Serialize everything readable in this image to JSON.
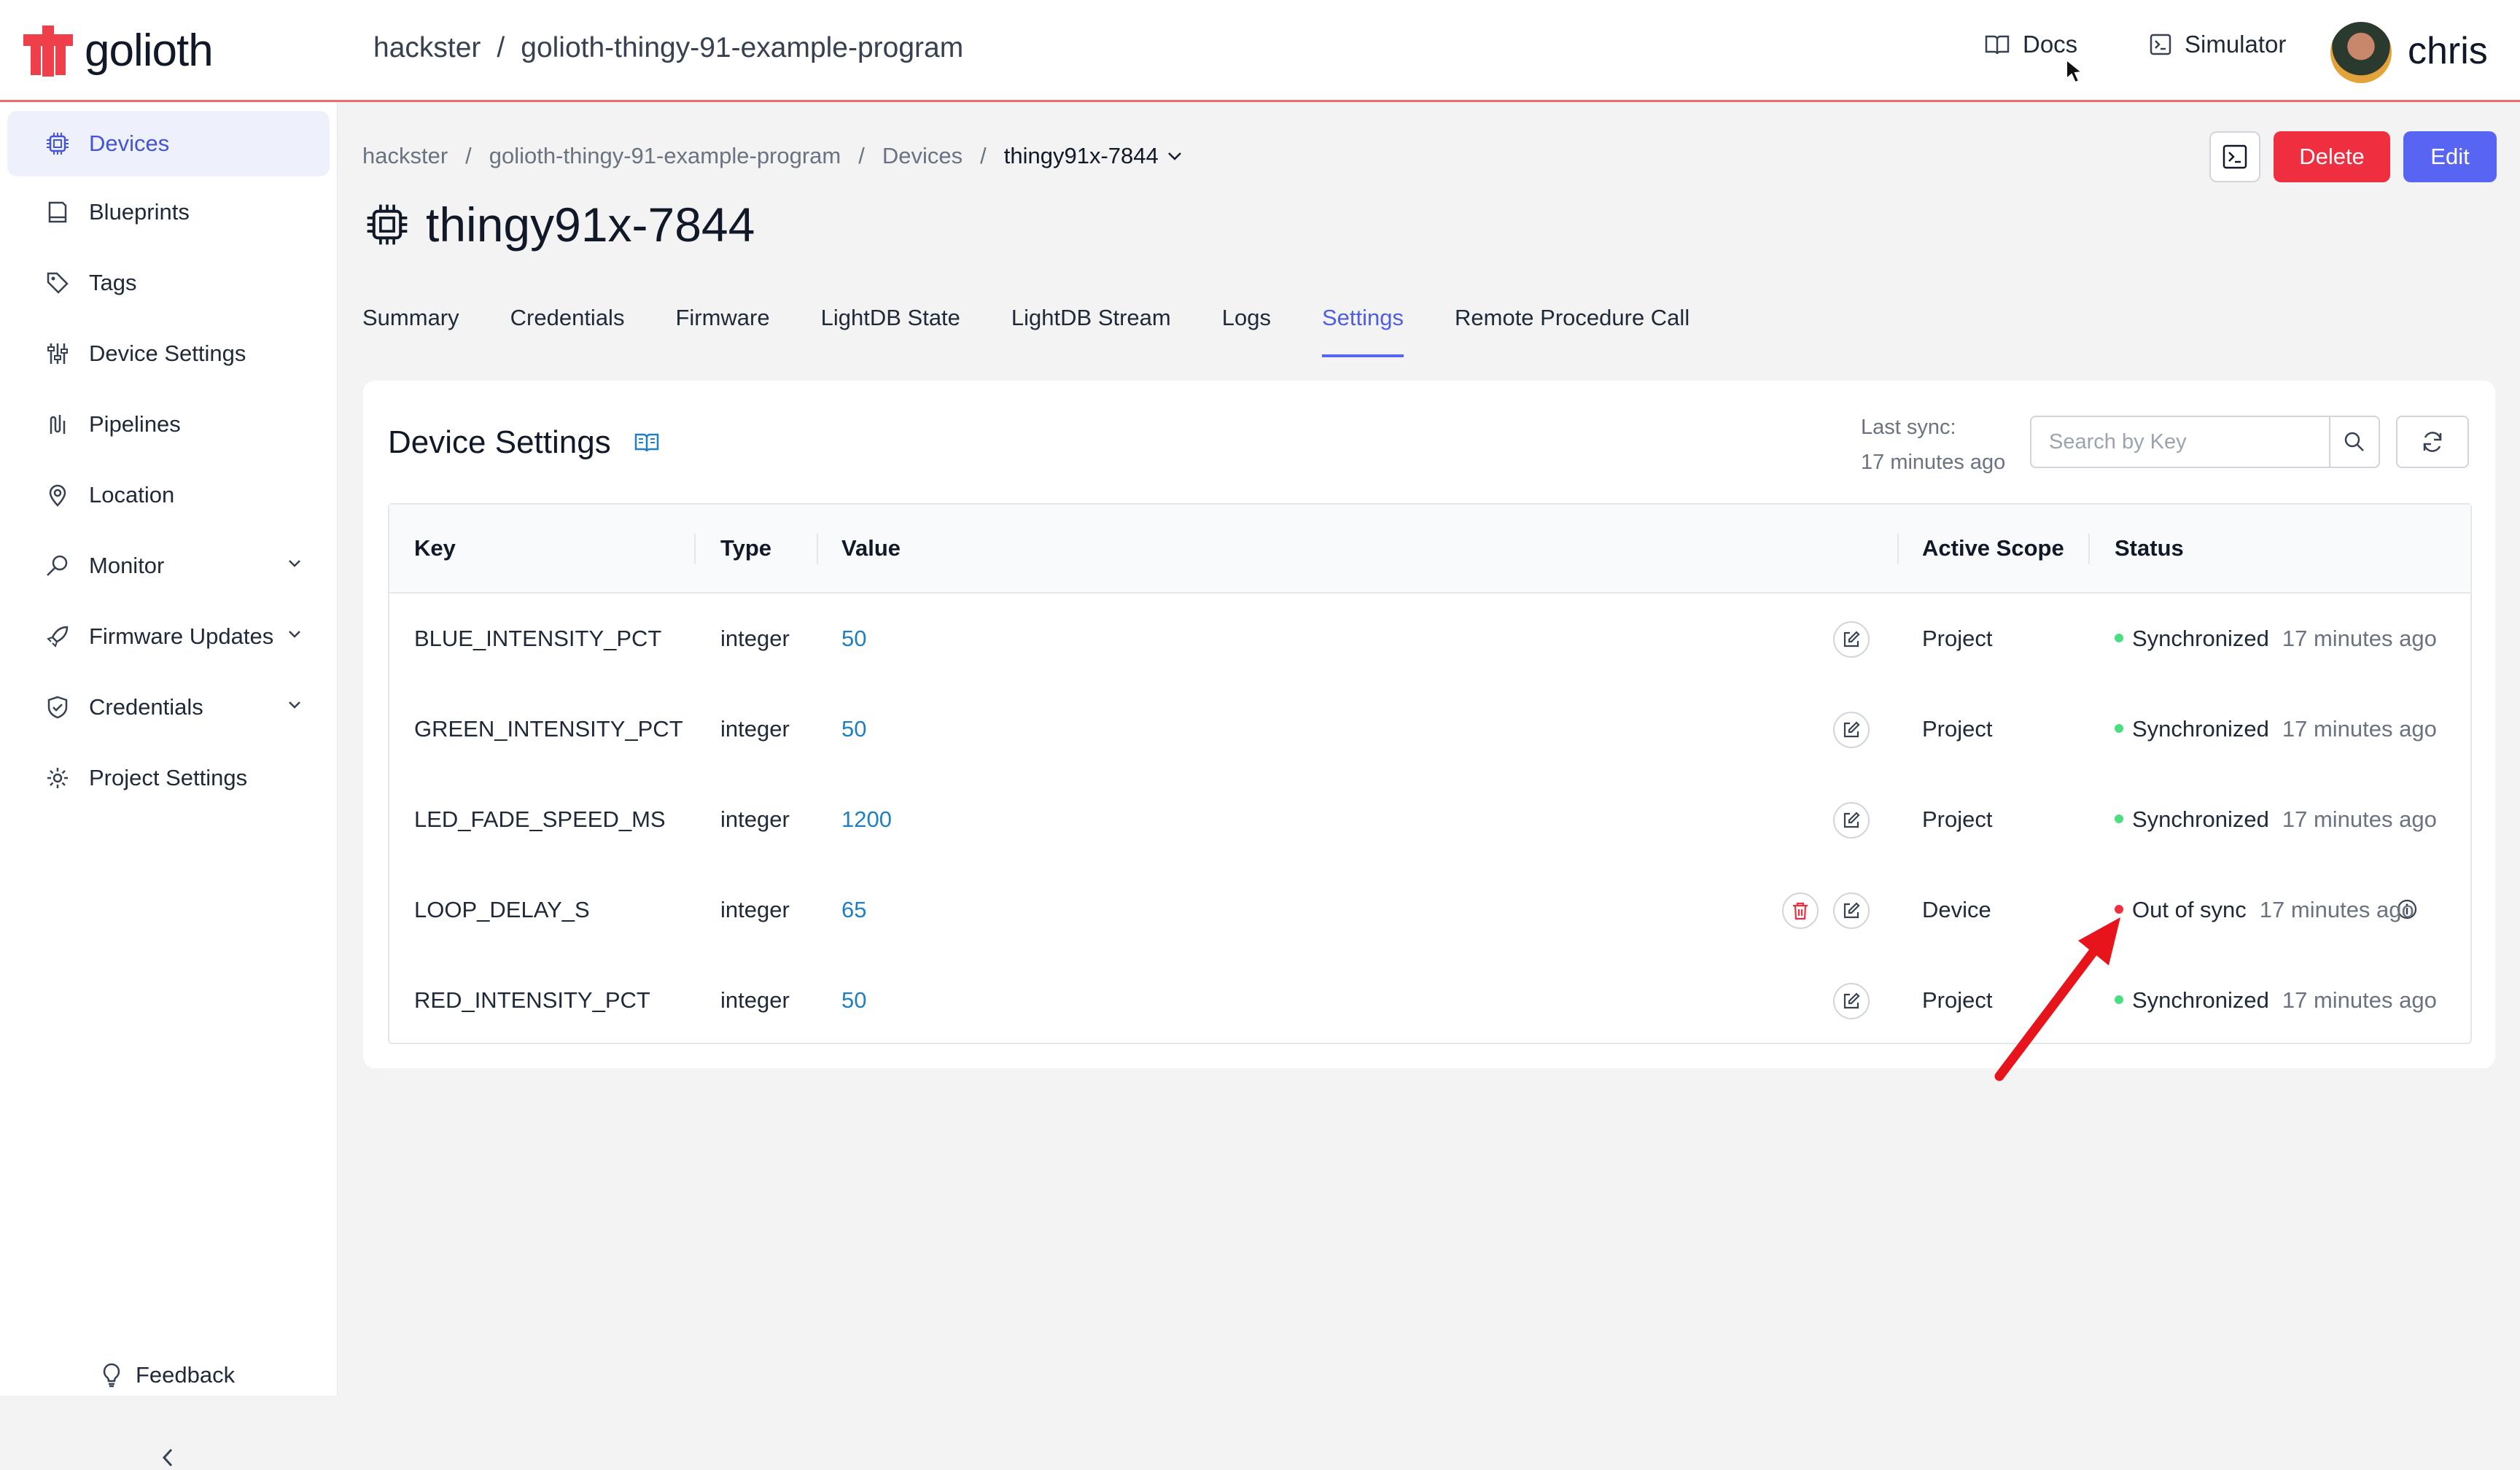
{
  "app": {
    "logo_text": "golioth",
    "brand_color": "#ef3f4a",
    "top_breadcrumb": {
      "org": "hackster",
      "sep": "/",
      "project": "golioth-thingy-91-example-program"
    },
    "nav": {
      "docs": "Docs",
      "simulator": "Simulator"
    },
    "user": {
      "name": "chris"
    }
  },
  "sidebar": {
    "items": [
      {
        "label": "Devices",
        "icon": "chip-icon",
        "active": true
      },
      {
        "label": "Blueprints",
        "icon": "blueprint-icon"
      },
      {
        "label": "Tags",
        "icon": "tag-icon"
      },
      {
        "label": "Device Settings",
        "icon": "sliders-icon"
      },
      {
        "label": "Pipelines",
        "icon": "pipeline-icon"
      },
      {
        "label": "Location",
        "icon": "map-pin-icon"
      },
      {
        "label": "Monitor",
        "icon": "monitor-icon",
        "expandable": true
      },
      {
        "label": "Firmware Updates",
        "icon": "rocket-icon",
        "expandable": true
      },
      {
        "label": "Credentials",
        "icon": "shield-check-icon",
        "expandable": true
      },
      {
        "label": "Project Settings",
        "icon": "gear-icon"
      }
    ],
    "feedback": "Feedback"
  },
  "breadcrumb": {
    "org": "hackster",
    "project": "golioth-thingy-91-example-program",
    "section": "Devices",
    "device": "thingy91x-7844",
    "sep": "/"
  },
  "header": {
    "title": "thingy91x-7844",
    "delete_label": "Delete",
    "edit_label": "Edit",
    "delete_color": "#ef2e3f",
    "edit_color": "#5865f2"
  },
  "tabs": [
    {
      "label": "Summary"
    },
    {
      "label": "Credentials"
    },
    {
      "label": "Firmware"
    },
    {
      "label": "LightDB State"
    },
    {
      "label": "LightDB Stream"
    },
    {
      "label": "Logs"
    },
    {
      "label": "Settings",
      "active": true
    },
    {
      "label": "Remote Procedure Call"
    }
  ],
  "settings": {
    "title": "Device Settings",
    "last_sync_label": "Last sync:",
    "last_sync_value": "17 minutes ago",
    "search_placeholder": "Search by Key",
    "columns": {
      "key": "Key",
      "type": "Type",
      "value": "Value",
      "scope": "Active Scope",
      "status": "Status"
    },
    "rows": [
      {
        "key": "BLUE_INTENSITY_PCT",
        "type": "integer",
        "value": "50",
        "scope": "Project",
        "status": "Synchronized",
        "ago": "17 minutes ago",
        "status_color": "#4ade80"
      },
      {
        "key": "GREEN_INTENSITY_PCT",
        "type": "integer",
        "value": "50",
        "scope": "Project",
        "status": "Synchronized",
        "ago": "17 minutes ago",
        "status_color": "#4ade80"
      },
      {
        "key": "LED_FADE_SPEED_MS",
        "type": "integer",
        "value": "1200",
        "scope": "Project",
        "status": "Synchronized",
        "ago": "17 minutes ago",
        "status_color": "#4ade80"
      },
      {
        "key": "LOOP_DELAY_S",
        "type": "integer",
        "value": "65",
        "scope": "Device",
        "status": "Out of sync",
        "ago": "17 minutes ago",
        "status_color": "#ef2e3f"
      },
      {
        "key": "RED_INTENSITY_PCT",
        "type": "integer",
        "value": "50",
        "scope": "Project",
        "status": "Synchronized",
        "ago": "17 minutes ago",
        "status_color": "#4ade80"
      }
    ]
  },
  "annotation": {
    "arrow_color": "#e8141c"
  }
}
